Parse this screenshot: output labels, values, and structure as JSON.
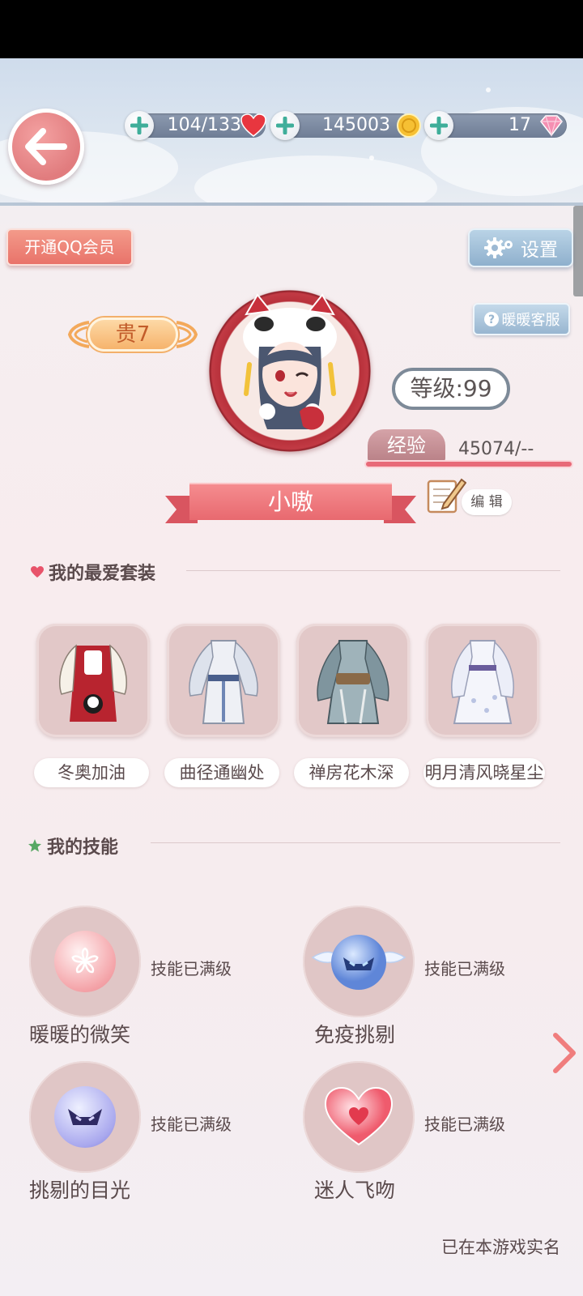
{
  "resources": {
    "stamina": "104/133",
    "gold": "145003",
    "diamonds": "17"
  },
  "buttons": {
    "qq_member": "开通QQ会员",
    "settings": "设置",
    "customer_service": "暖暖客服",
    "edit": "编 辑"
  },
  "profile": {
    "vip": "贵7",
    "level": "等级:99",
    "exp_label": "经验",
    "exp_value": "45074/--",
    "name": "小嗷"
  },
  "favorites": {
    "title": "我的最爱套装",
    "outfits": [
      {
        "name": "冬奥加油"
      },
      {
        "name": "曲径通幽处"
      },
      {
        "name": "禅房花木深"
      },
      {
        "name": "明月清风晓星尘"
      }
    ]
  },
  "skills": {
    "title": "我的技能",
    "items": [
      {
        "name": "暖暖的微笑",
        "status": "技能已满级"
      },
      {
        "name": "免疫挑剔",
        "status": "技能已满级"
      },
      {
        "name": "挑剔的目光",
        "status": "技能已满级"
      },
      {
        "name": "迷人飞吻",
        "status": "技能已满级"
      }
    ]
  },
  "footer": {
    "realname_note": "已在本游戏实名"
  },
  "colors": {
    "accent_red": "#e8696f",
    "settings_blue": "#8fb0cd",
    "vip_orange": "#f6b36c"
  }
}
